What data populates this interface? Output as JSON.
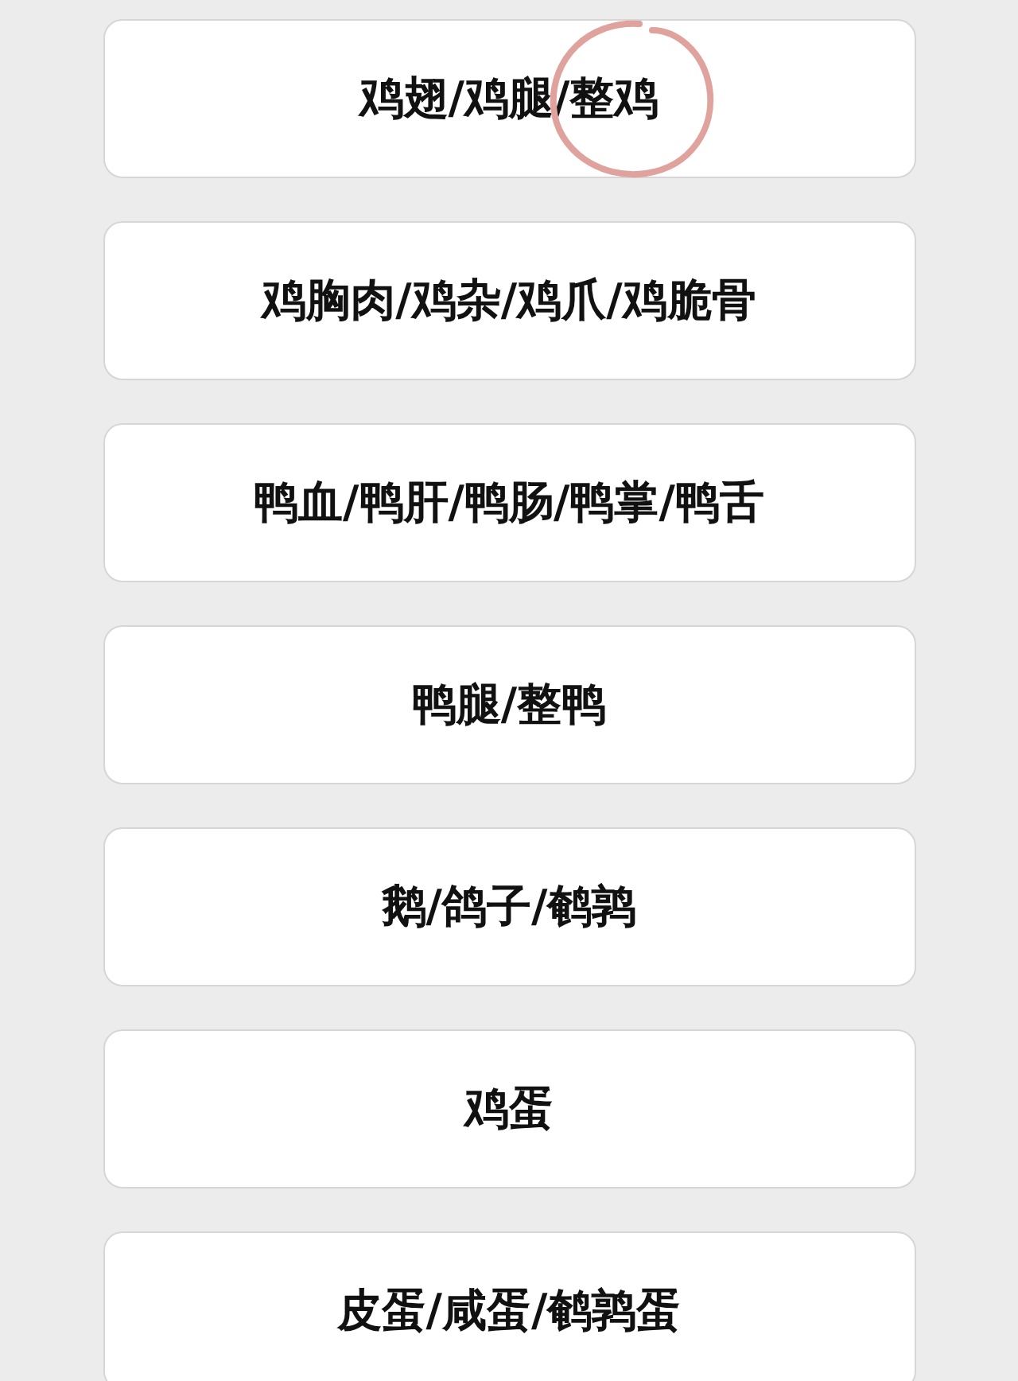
{
  "categories": [
    {
      "label": "鸡翅/鸡腿/整鸡",
      "circled": true
    },
    {
      "label": "鸡胸肉/鸡杂/鸡爪/鸡脆骨",
      "circled": false
    },
    {
      "label": "鸭血/鸭肝/鸭肠/鸭掌/鸭舌",
      "circled": false
    },
    {
      "label": "鸭腿/整鸭",
      "circled": false
    },
    {
      "label": "鹅/鸽子/鹌鹑",
      "circled": false
    },
    {
      "label": "鸡蛋",
      "circled": false
    },
    {
      "label": "皮蛋/咸蛋/鹌鹑蛋",
      "circled": false
    }
  ]
}
